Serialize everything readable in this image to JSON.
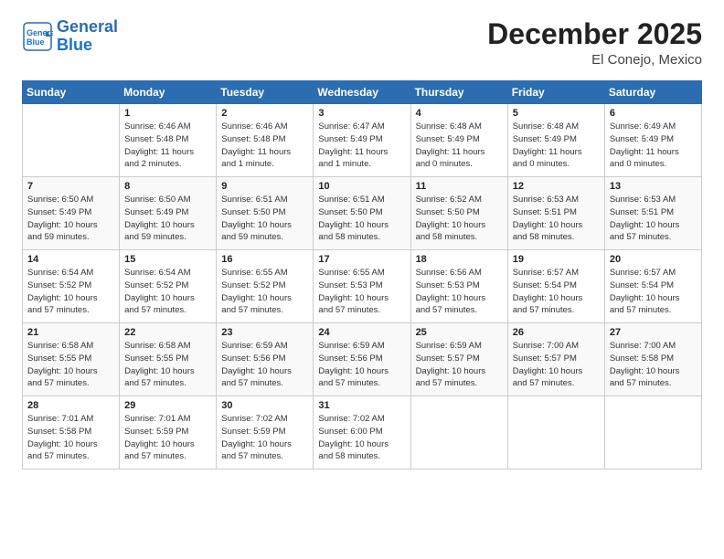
{
  "header": {
    "logo_general": "General",
    "logo_blue": "Blue",
    "month": "December 2025",
    "location": "El Conejo, Mexico"
  },
  "weekdays": [
    "Sunday",
    "Monday",
    "Tuesday",
    "Wednesday",
    "Thursday",
    "Friday",
    "Saturday"
  ],
  "weeks": [
    [
      {
        "day": "",
        "text": ""
      },
      {
        "day": "1",
        "text": "Sunrise: 6:46 AM\nSunset: 5:48 PM\nDaylight: 11 hours\nand 2 minutes."
      },
      {
        "day": "2",
        "text": "Sunrise: 6:46 AM\nSunset: 5:48 PM\nDaylight: 11 hours\nand 1 minute."
      },
      {
        "day": "3",
        "text": "Sunrise: 6:47 AM\nSunset: 5:49 PM\nDaylight: 11 hours\nand 1 minute."
      },
      {
        "day": "4",
        "text": "Sunrise: 6:48 AM\nSunset: 5:49 PM\nDaylight: 11 hours\nand 0 minutes."
      },
      {
        "day": "5",
        "text": "Sunrise: 6:48 AM\nSunset: 5:49 PM\nDaylight: 11 hours\nand 0 minutes."
      },
      {
        "day": "6",
        "text": "Sunrise: 6:49 AM\nSunset: 5:49 PM\nDaylight: 11 hours\nand 0 minutes."
      }
    ],
    [
      {
        "day": "7",
        "text": "Sunrise: 6:50 AM\nSunset: 5:49 PM\nDaylight: 10 hours\nand 59 minutes."
      },
      {
        "day": "8",
        "text": "Sunrise: 6:50 AM\nSunset: 5:49 PM\nDaylight: 10 hours\nand 59 minutes."
      },
      {
        "day": "9",
        "text": "Sunrise: 6:51 AM\nSunset: 5:50 PM\nDaylight: 10 hours\nand 59 minutes."
      },
      {
        "day": "10",
        "text": "Sunrise: 6:51 AM\nSunset: 5:50 PM\nDaylight: 10 hours\nand 58 minutes."
      },
      {
        "day": "11",
        "text": "Sunrise: 6:52 AM\nSunset: 5:50 PM\nDaylight: 10 hours\nand 58 minutes."
      },
      {
        "day": "12",
        "text": "Sunrise: 6:53 AM\nSunset: 5:51 PM\nDaylight: 10 hours\nand 58 minutes."
      },
      {
        "day": "13",
        "text": "Sunrise: 6:53 AM\nSunset: 5:51 PM\nDaylight: 10 hours\nand 57 minutes."
      }
    ],
    [
      {
        "day": "14",
        "text": "Sunrise: 6:54 AM\nSunset: 5:52 PM\nDaylight: 10 hours\nand 57 minutes."
      },
      {
        "day": "15",
        "text": "Sunrise: 6:54 AM\nSunset: 5:52 PM\nDaylight: 10 hours\nand 57 minutes."
      },
      {
        "day": "16",
        "text": "Sunrise: 6:55 AM\nSunset: 5:52 PM\nDaylight: 10 hours\nand 57 minutes."
      },
      {
        "day": "17",
        "text": "Sunrise: 6:55 AM\nSunset: 5:53 PM\nDaylight: 10 hours\nand 57 minutes."
      },
      {
        "day": "18",
        "text": "Sunrise: 6:56 AM\nSunset: 5:53 PM\nDaylight: 10 hours\nand 57 minutes."
      },
      {
        "day": "19",
        "text": "Sunrise: 6:57 AM\nSunset: 5:54 PM\nDaylight: 10 hours\nand 57 minutes."
      },
      {
        "day": "20",
        "text": "Sunrise: 6:57 AM\nSunset: 5:54 PM\nDaylight: 10 hours\nand 57 minutes."
      }
    ],
    [
      {
        "day": "21",
        "text": "Sunrise: 6:58 AM\nSunset: 5:55 PM\nDaylight: 10 hours\nand 57 minutes."
      },
      {
        "day": "22",
        "text": "Sunrise: 6:58 AM\nSunset: 5:55 PM\nDaylight: 10 hours\nand 57 minutes."
      },
      {
        "day": "23",
        "text": "Sunrise: 6:59 AM\nSunset: 5:56 PM\nDaylight: 10 hours\nand 57 minutes."
      },
      {
        "day": "24",
        "text": "Sunrise: 6:59 AM\nSunset: 5:56 PM\nDaylight: 10 hours\nand 57 minutes."
      },
      {
        "day": "25",
        "text": "Sunrise: 6:59 AM\nSunset: 5:57 PM\nDaylight: 10 hours\nand 57 minutes."
      },
      {
        "day": "26",
        "text": "Sunrise: 7:00 AM\nSunset: 5:57 PM\nDaylight: 10 hours\nand 57 minutes."
      },
      {
        "day": "27",
        "text": "Sunrise: 7:00 AM\nSunset: 5:58 PM\nDaylight: 10 hours\nand 57 minutes."
      }
    ],
    [
      {
        "day": "28",
        "text": "Sunrise: 7:01 AM\nSunset: 5:58 PM\nDaylight: 10 hours\nand 57 minutes."
      },
      {
        "day": "29",
        "text": "Sunrise: 7:01 AM\nSunset: 5:59 PM\nDaylight: 10 hours\nand 57 minutes."
      },
      {
        "day": "30",
        "text": "Sunrise: 7:02 AM\nSunset: 5:59 PM\nDaylight: 10 hours\nand 57 minutes."
      },
      {
        "day": "31",
        "text": "Sunrise: 7:02 AM\nSunset: 6:00 PM\nDaylight: 10 hours\nand 58 minutes."
      },
      {
        "day": "",
        "text": ""
      },
      {
        "day": "",
        "text": ""
      },
      {
        "day": "",
        "text": ""
      }
    ]
  ]
}
